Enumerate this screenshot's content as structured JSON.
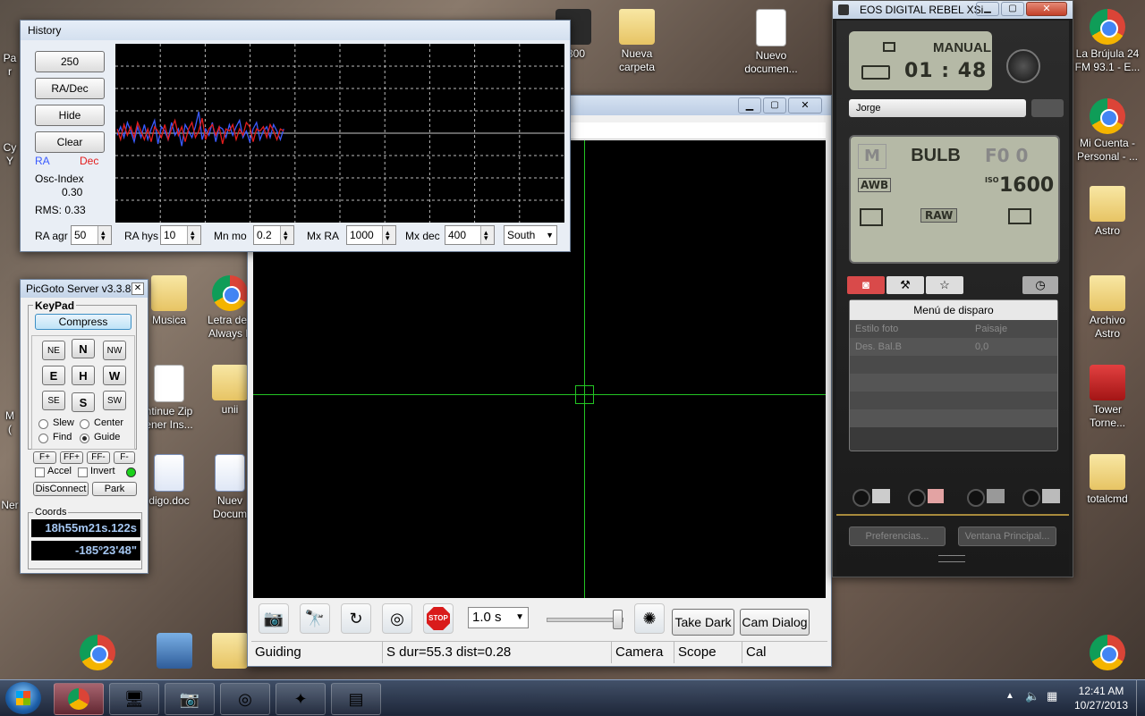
{
  "desktop_left": [
    {
      "label": "Pa\nr"
    },
    {
      "label": "Cy\nY"
    },
    {
      "label": "M\n("
    },
    {
      "label": "Ner"
    }
  ],
  "desktop_mid": [
    {
      "label": "Musica"
    },
    {
      "label": "Letra de l\nAlways L"
    },
    {
      "label": "ntinue Zip\nener Ins..."
    },
    {
      "label": "unii"
    },
    {
      "label": "digo.doc"
    },
    {
      "label": "Nuev\nDocum"
    }
  ],
  "desktop_top": [
    {
      "label": "c800"
    },
    {
      "label": "Nueva\ncarpeta"
    },
    {
      "label": "Nuevo\ndocumen..."
    }
  ],
  "desktop_right": [
    {
      "label": "La Brújula 24\nFM 93.1 - E..."
    },
    {
      "label": "Mi Cuenta -\nPersonal - ..."
    },
    {
      "label": "Astro"
    },
    {
      "label": "Archivo\nAstro"
    },
    {
      "label": "Tower\nTorne..."
    },
    {
      "label": "totalcmd"
    }
  ],
  "history": {
    "title": "History",
    "buttons": [
      "250",
      "RA/Dec",
      "Hide",
      "Clear"
    ],
    "legend_ra": "RA",
    "legend_dec": "Dec",
    "osc_label": "Osc-Index",
    "osc_value": "0.30",
    "rms": "RMS: 0.33",
    "params": [
      {
        "label": "RA agr",
        "value": "50"
      },
      {
        "label": "RA hys",
        "value": "10"
      },
      {
        "label": "Mn mo",
        "value": "0.2"
      },
      {
        "label": "Mx RA",
        "value": "1000"
      },
      {
        "label": "Mx dec",
        "value": "400"
      }
    ],
    "dec_mode": "South"
  },
  "guide": {
    "exposure": "1.0 s",
    "take_dark": "Take Dark",
    "cam_dialog": "Cam Dialog",
    "status": "Guiding",
    "status2": "S dur=55.3 dist=0.28",
    "status_camera": "Camera",
    "status_scope": "Scope",
    "status_cal": "Cal",
    "stop_label": "STOP",
    "crosshair_color": "#23c423"
  },
  "picgoto": {
    "title": "PicGoto Server v3.3.8",
    "keypad_label": "KeyPad",
    "compress": "Compress",
    "dirs": {
      "ne": "NE",
      "n": "N",
      "nw": "NW",
      "e": "E",
      "h": "H",
      "w": "W",
      "se": "SE",
      "s": "S",
      "sw": "SW"
    },
    "modes": [
      "Slew",
      "Center",
      "Find",
      "Guide"
    ],
    "selected_mode": "Guide",
    "ff": [
      "F+",
      "FF+",
      "FF-",
      "F-"
    ],
    "accel": "Accel",
    "invert": "Invert",
    "disconnect": "DisConnect",
    "park": "Park",
    "coords_label": "Coords",
    "ra": "18h55m21s.122s",
    "dec": "-185º23'48\""
  },
  "eos": {
    "title": "EOS DIGITAL REBEL XSi",
    "mode": "MANUAL",
    "shots": "01 : 48",
    "owner": "Jorge",
    "shooting_mode": "M",
    "shutter": "BULB",
    "aperture": "F0 0",
    "wb": "AWB",
    "iso_label": "ISO",
    "iso": "1600",
    "quality": "RAW",
    "menu_title": "Menú de disparo",
    "menu_rows": [
      {
        "name": "Estilo foto",
        "value": "Paisaje"
      },
      {
        "name": "Des. Bal.B",
        "value": "0,0"
      }
    ],
    "preferences": "Preferencias...",
    "main_window": "Ventana Principal..."
  },
  "taskbar": {
    "time": "12:41 AM",
    "date": "10/27/2013"
  },
  "chart_data": {
    "type": "line",
    "series": [
      {
        "name": "RA",
        "color": "#3a5bff",
        "values": [
          -0.1,
          0.3,
          -0.2,
          0.5,
          0.1,
          -0.4,
          0.3,
          -0.2,
          0.4,
          -0.3,
          0.2,
          0.6,
          -0.5,
          0.3,
          0.1,
          -0.3,
          0.5,
          -0.1,
          0.2,
          -0.6,
          0.4,
          0.1,
          -0.2,
          0.3,
          1.0,
          -0.3,
          0.2,
          -0.1,
          0.5,
          -0.4,
          0.3,
          0.2,
          -0.2,
          0.4,
          -0.1,
          0.3,
          0.6,
          -0.2,
          0.1,
          -0.4,
          0.2,
          0.5,
          -0.3,
          0.1,
          0.3,
          -0.2,
          0.4,
          0.1,
          -0.3,
          0.2
        ]
      },
      {
        "name": "Dec",
        "color": "#e31d1d",
        "values": [
          0.2,
          -0.3,
          0.4,
          -0.1,
          0.3,
          -0.2,
          0.5,
          0.1,
          -0.3,
          0.2,
          -0.4,
          0.3,
          0.1,
          -0.2,
          0.4,
          -0.3,
          0.2,
          0.6,
          -0.1,
          0.3,
          -0.4,
          0.2,
          0.5,
          -0.2,
          0.1,
          0.7,
          -0.3,
          0.2,
          0.4,
          -0.1,
          0.3,
          -0.5,
          0.2,
          0.1,
          0.4,
          -0.3,
          0.2,
          -0.1,
          0.5,
          0.3,
          -0.4,
          0.2,
          0.1,
          0.3,
          -0.2,
          0.4,
          0.1,
          -0.3,
          0.2,
          0.1
        ]
      }
    ]
  }
}
